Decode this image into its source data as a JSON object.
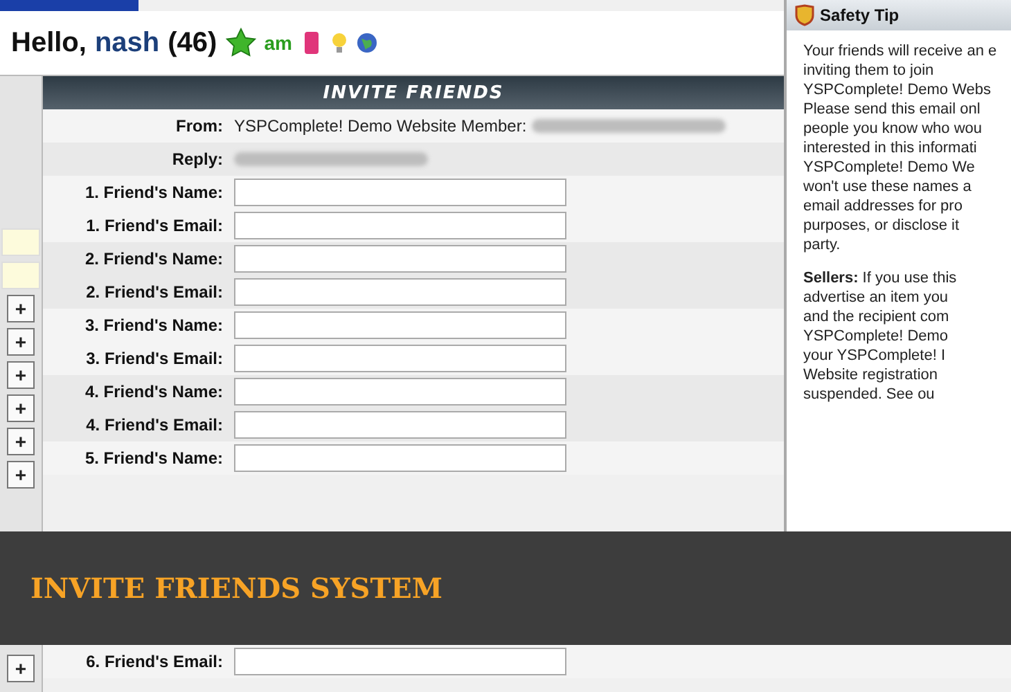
{
  "header": {
    "greeting": "Hello,",
    "username": "nash",
    "score": "(46)",
    "badge_text": "am"
  },
  "form": {
    "title": "INVITE FRIENDS",
    "from": {
      "label": "From:",
      "value": "YSPComplete! Demo Website Member:"
    },
    "reply": {
      "label": "Reply:"
    },
    "rows_above": [
      {
        "label": "1. Friend's Name:"
      },
      {
        "label": "1. Friend's Email:"
      },
      {
        "label": "2. Friend's Name:"
      },
      {
        "label": "2. Friend's Email:"
      },
      {
        "label": "3. Friend's Name:"
      },
      {
        "label": "3. Friend's Email:"
      },
      {
        "label": "4. Friend's Name:"
      },
      {
        "label": "4. Friend's Email:"
      },
      {
        "label": "5. Friend's Name:"
      }
    ],
    "rows_below": [
      {
        "label": "6. Friend's Email:"
      }
    ]
  },
  "sidebar": {
    "buttons": [
      "+",
      "+",
      "+",
      "+",
      "+",
      "+"
    ]
  },
  "safety_tip": {
    "title": "Safety Tip",
    "paragraph_1": [
      "Your friends will receive an e",
      "inviting them to join",
      "YSPComplete! Demo Webs",
      "Please send this email onl",
      "people you know who wou",
      "interested in this informati",
      "YSPComplete! Demo We",
      "won't use these names a",
      "email addresses for pro",
      "purposes, or disclose it",
      "party."
    ],
    "paragraph_2": [
      "**Sellers:** If you use this",
      "advertise an item you",
      "and the recipient com",
      "YSPComplete! Demo",
      "your YSPComplete! I",
      "Website registration",
      "suspended. See ou"
    ]
  },
  "banner": {
    "title": "INVITE FRIENDS SYSTEM"
  }
}
